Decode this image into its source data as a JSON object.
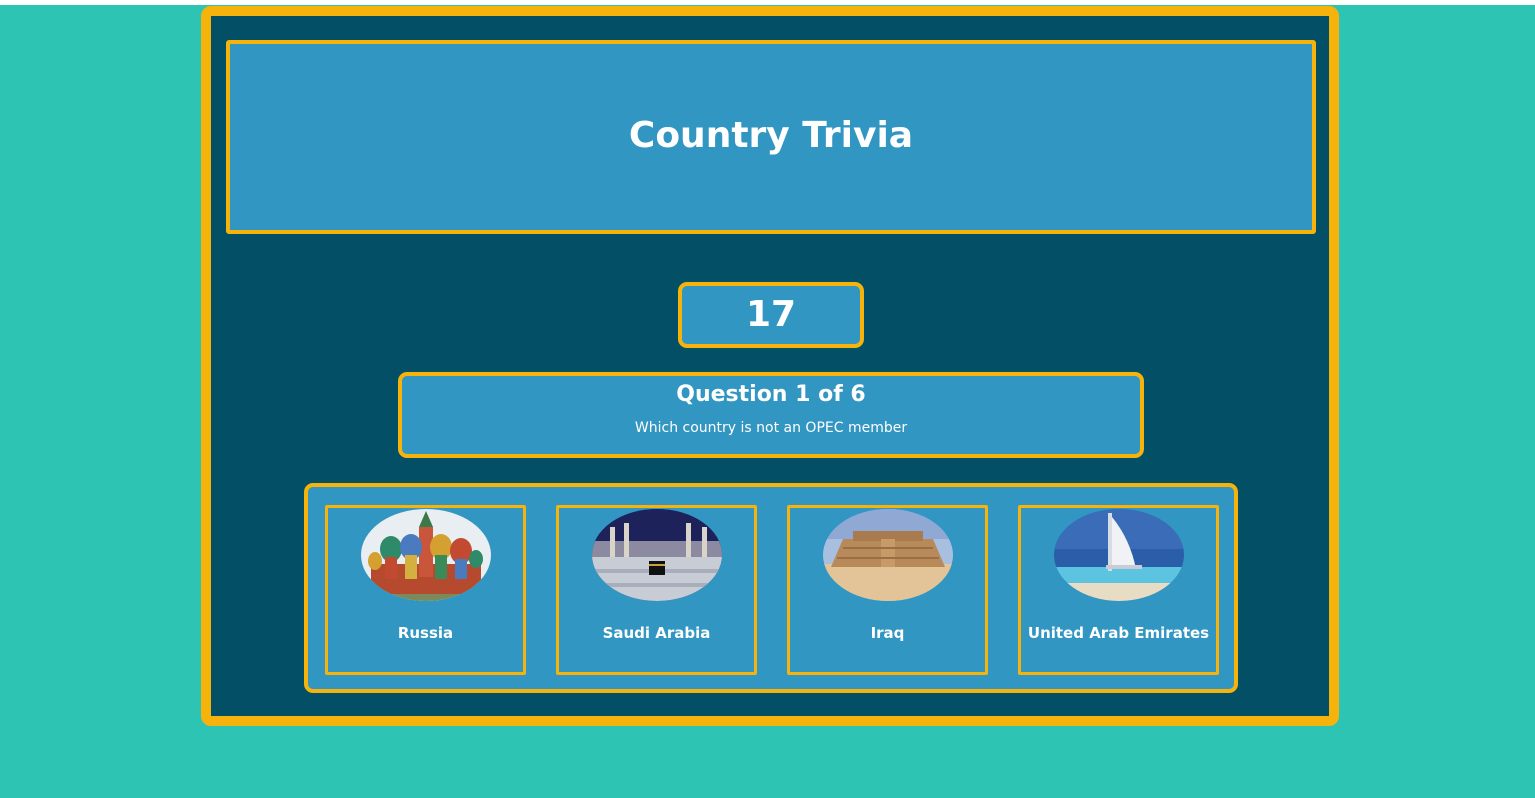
{
  "header": {
    "title": "Country Trivia"
  },
  "timer": {
    "value": "17"
  },
  "question": {
    "number_label": "Question 1 of 6",
    "text": "Which country is not an OPEC member"
  },
  "answers": [
    {
      "label": "Russia",
      "image": "st-basils-cathedral-image"
    },
    {
      "label": "Saudi Arabia",
      "image": "kaaba-mecca-image"
    },
    {
      "label": "Iraq",
      "image": "ziggurat-ur-image"
    },
    {
      "label": "United Arab Emirates",
      "image": "burj-al-arab-image"
    }
  ],
  "colors": {
    "page_background": "#2ec4b4",
    "frame": "#034f66",
    "panel": "#3196c2",
    "accent_border": "#f5b30b",
    "text": "#ffffff"
  }
}
